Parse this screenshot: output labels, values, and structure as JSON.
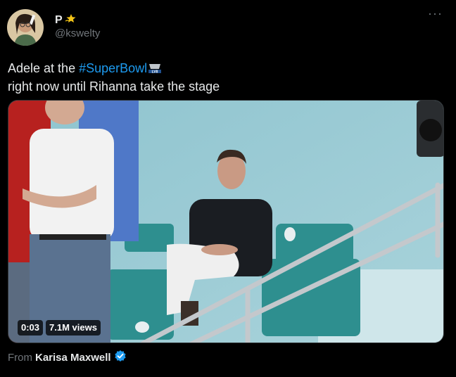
{
  "author": {
    "display_name": "P",
    "name_emoji_icon": "sparkle-star-icon",
    "handle": "@kswelty"
  },
  "tweet": {
    "text_line1_prefix": "Adele at the ",
    "hashtag": "#SuperBowl",
    "hashtag_icon": "super-bowl-lvii-icon",
    "text_line2": "right now until Rihanna take the stage"
  },
  "video": {
    "timestamp": "0:03",
    "views": "7.1M views"
  },
  "attribution": {
    "prefix": "From",
    "source_name": "Karisa Maxwell",
    "verified_icon": "verified-badge-icon"
  },
  "colors": {
    "background": "#000000",
    "text": "#e7e9ea",
    "secondary_text": "#71767b",
    "link": "#1d9bf0"
  }
}
